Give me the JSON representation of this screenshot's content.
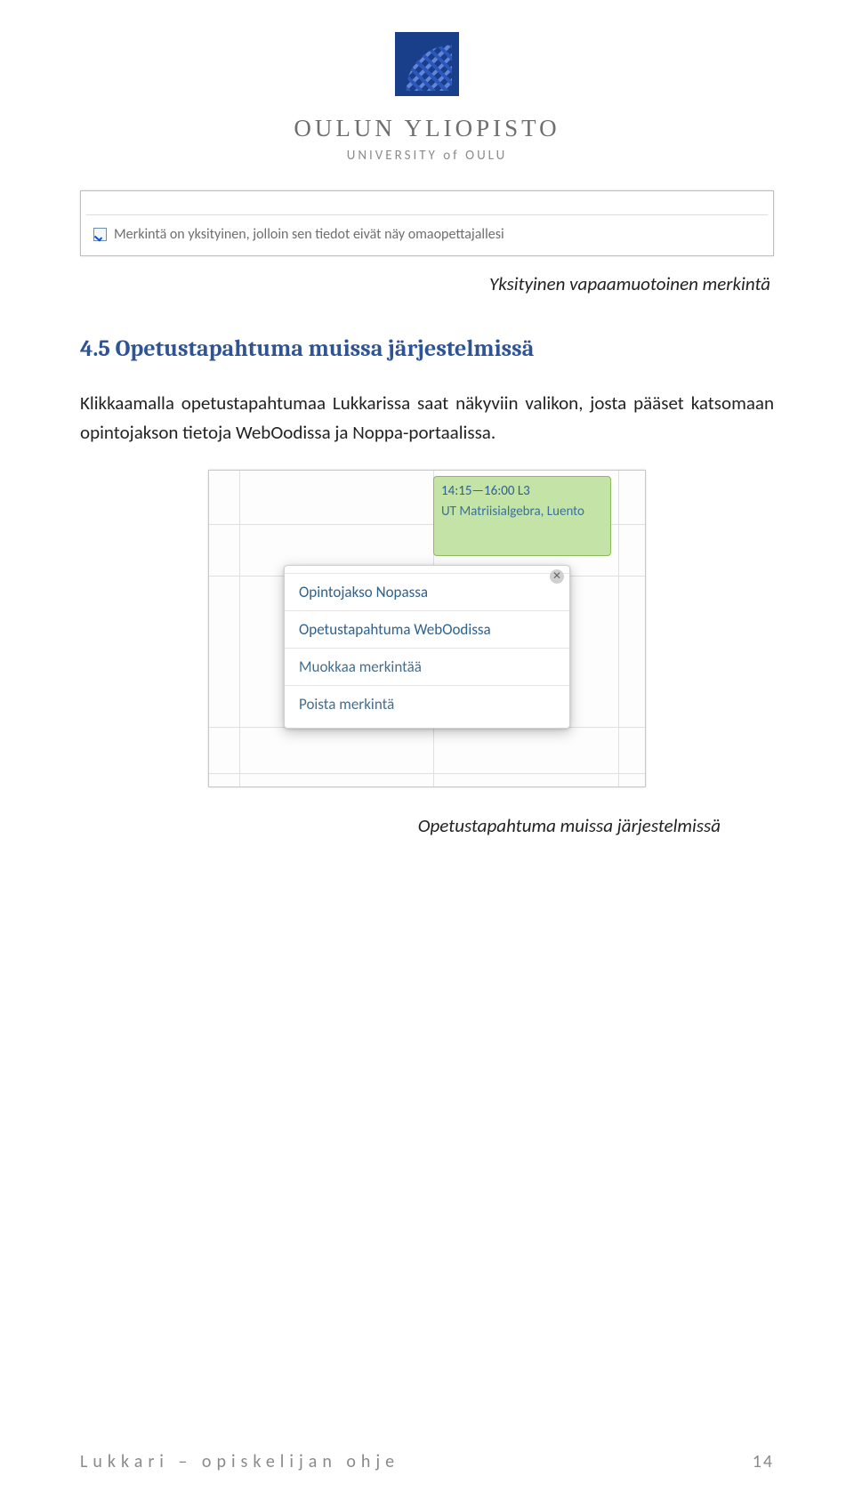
{
  "logo": {
    "line1": "OULUN YLIOPISTO",
    "line2": "UNIVERSITY of OULU"
  },
  "screenshot1": {
    "checkbox_label": "Merkintä on yksityinen, jolloin sen tiedot eivät näy omaopettajallesi"
  },
  "caption1": "Yksityinen vapaamuotoinen merkintä",
  "heading": "4.5 Opetustapahtuma muissa järjestelmissä",
  "body_paragraph": "Klikkaamalla opetustapahtumaa Lukkarissa saat näkyviin valikon, josta pääset katsomaan opintojakson tietoja WebOodissa ja Noppa-portaalissa.",
  "screenshot2": {
    "event": {
      "time": "14:15—16:00 L3",
      "title": "UT Matriisialgebra, Luento"
    },
    "popup_items": [
      "Opintojakso Nopassa",
      "Opetustapahtuma WebOodissa",
      "Muokkaa merkintää",
      "Poista merkintä"
    ]
  },
  "caption2": "Opetustapahtuma muissa järjestelmissä",
  "footer": {
    "text": "Lukkari – opiskelijan ohje",
    "page": "14"
  }
}
